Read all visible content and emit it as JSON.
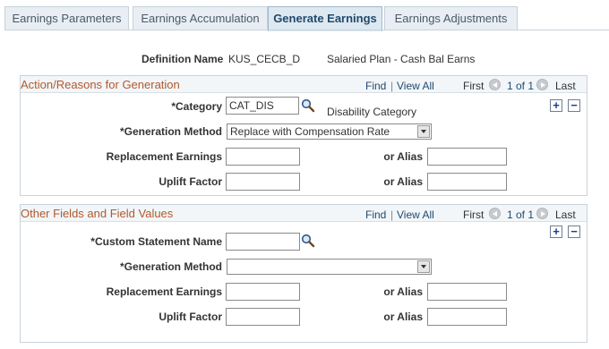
{
  "tabs": [
    {
      "label": "Earnings Parameters",
      "active": false
    },
    {
      "label": "Earnings Accumulation",
      "active": false
    },
    {
      "label": "Generate Earnings",
      "active": true
    },
    {
      "label": "Earnings Adjustments",
      "active": false
    }
  ],
  "definition": {
    "label": "Definition Name",
    "code": "KUS_CECB_D",
    "description": "Salaried Plan - Cash Bal Earns"
  },
  "nav": {
    "find": "Find",
    "sep": "|",
    "view_all": "View All",
    "first": "First",
    "count": "1 of 1",
    "last": "Last"
  },
  "action_group": {
    "title": "Action/Reasons for Generation",
    "category_label": "*Category",
    "category_value": "CAT_DIS",
    "category_desc": "Disability Category",
    "gen_method_label": "*Generation Method",
    "gen_method_value": "Replace with Compensation Rate",
    "replacement_label": "Replacement Earnings",
    "replacement_value": "",
    "alias_label": "or Alias",
    "alias_value": "",
    "uplift_label": "Uplift Factor",
    "uplift_value": "",
    "alias2_label": "or Alias",
    "alias2_value": ""
  },
  "other_group": {
    "title": "Other Fields and Field Values",
    "custom_label": "*Custom Statement Name",
    "custom_value": "",
    "gen_method_label": "*Generation Method",
    "gen_method_value": "",
    "replacement_label": "Replacement Earnings",
    "replacement_value": "",
    "alias_label": "or Alias",
    "alias_value": "",
    "uplift_label": "Uplift Factor",
    "uplift_value": "",
    "alias2_label": "or Alias",
    "alias2_value": ""
  },
  "icons": {
    "lookup": "magnifier-icon",
    "add": "plus-icon",
    "remove": "minus-icon",
    "prev": "previous-arrow-icon",
    "next": "next-arrow-icon"
  },
  "colors": {
    "group_title": "#b2592c",
    "link": "#1f4a6e",
    "tab_active_bg": "#dde8f0"
  }
}
